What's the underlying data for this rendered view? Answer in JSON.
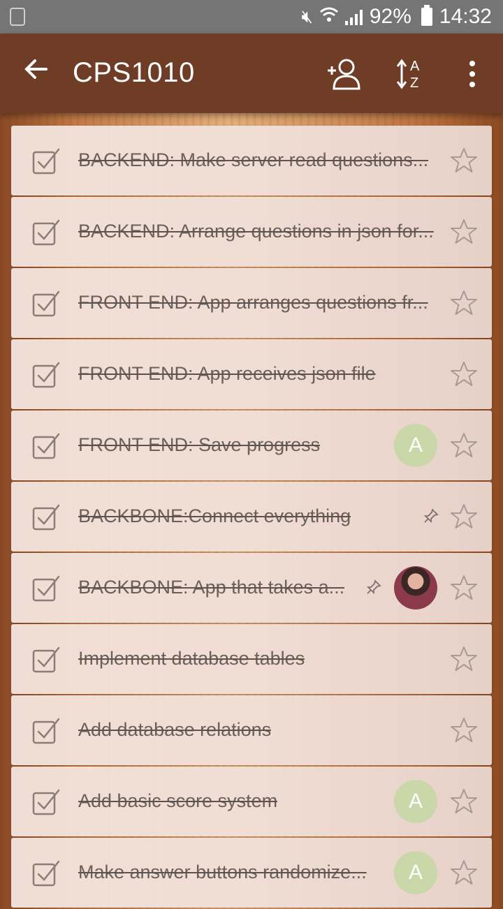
{
  "status_bar": {
    "battery": "92%",
    "time": "14:32",
    "icons": [
      "recycle-icon",
      "mute-vibrate-icon",
      "wifi-icon",
      "signal-icon",
      "battery-icon"
    ]
  },
  "app_bar": {
    "title": "CPS1010",
    "icons": [
      "back-arrow-icon",
      "add-person-icon",
      "sort-az-icon",
      "more-vert-icon"
    ],
    "sort_letters": [
      "A",
      "Z"
    ]
  },
  "tasks": [
    {
      "text": "BACKEND:  Make server read questions...",
      "completed": true,
      "starred": false
    },
    {
      "text": "BACKEND: Arrange questions in json for...",
      "completed": true,
      "starred": false
    },
    {
      "text": "FRONT END: App arranges questions fr...",
      "completed": true,
      "starred": false
    },
    {
      "text": "FRONT END:  App receives json file",
      "completed": true,
      "starred": false
    },
    {
      "text": "FRONT END: Save progress",
      "completed": true,
      "starred": false,
      "avatar": "A"
    },
    {
      "text": "BACKBONE:Connect everything",
      "completed": true,
      "starred": false,
      "pinned": true
    },
    {
      "text": "BACKBONE: App that takes a...",
      "completed": true,
      "starred": false,
      "pinned": true,
      "avatar": "photo"
    },
    {
      "text": "Implement database tables",
      "completed": true,
      "starred": false
    },
    {
      "text": "Add database relations",
      "completed": true,
      "starred": false
    },
    {
      "text": "Add basic score system",
      "completed": true,
      "starred": false,
      "avatar": "A"
    },
    {
      "text": "Make answer buttons randomize...",
      "completed": true,
      "starred": false,
      "avatar": "A"
    }
  ],
  "colors": {
    "status_bar": "#757575",
    "app_bar": "#6f3c25",
    "avatar_a": "#c9d7a9",
    "task_text": "#6b5f5a"
  }
}
